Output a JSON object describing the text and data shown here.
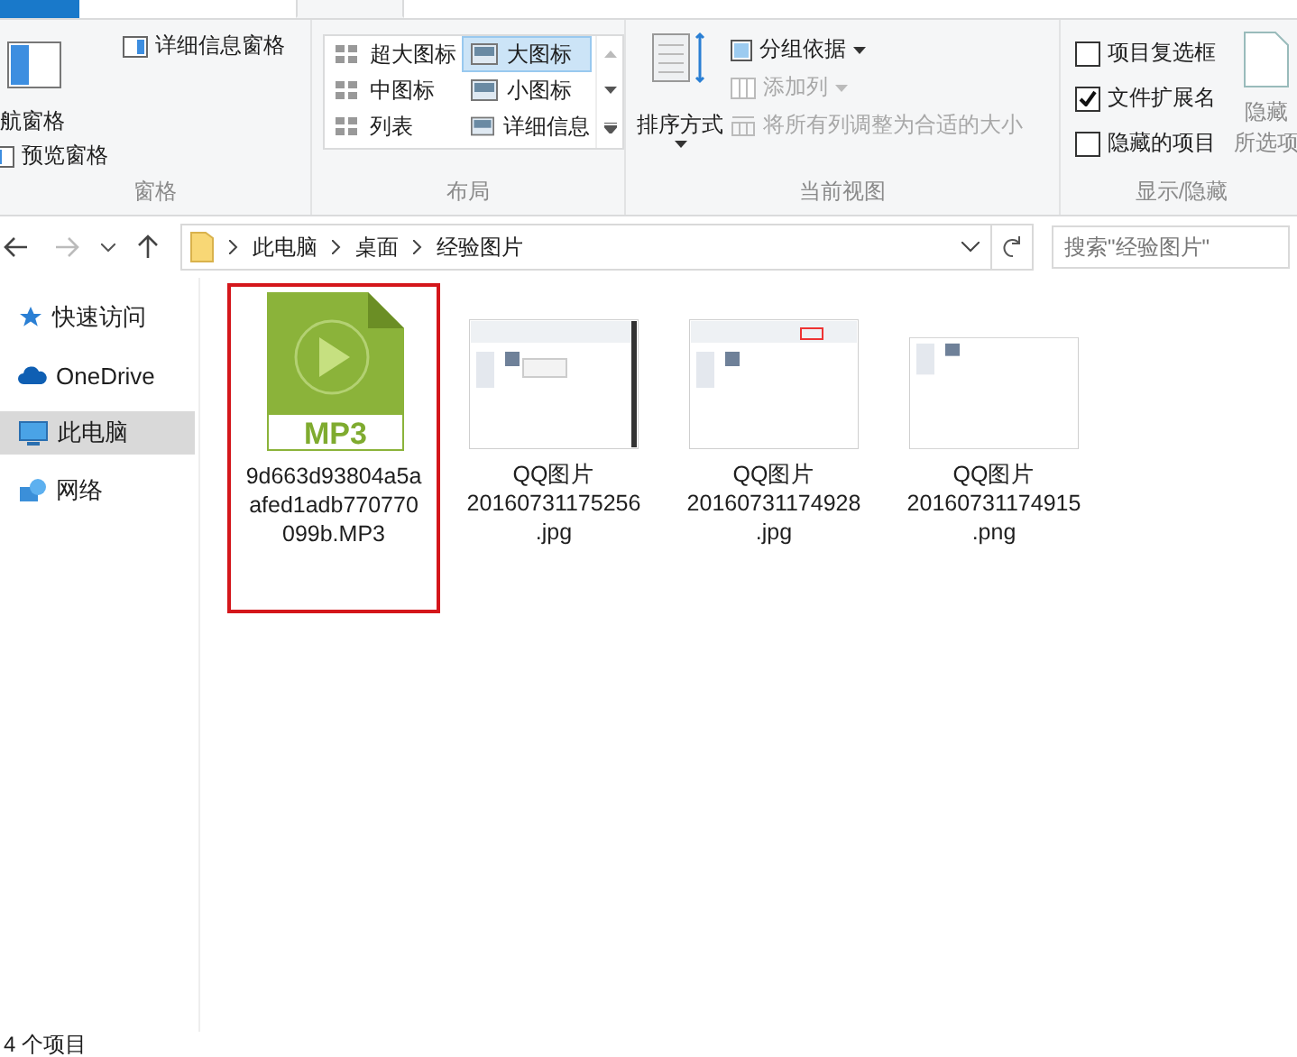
{
  "ribbon": {
    "panes": {
      "nav_pane": "航窗格",
      "preview_pane": "预览窗格",
      "details_pane": "详细信息窗格",
      "label": "窗格"
    },
    "layout": {
      "options": [
        {
          "label": "超大图标",
          "selected": false
        },
        {
          "label": "大图标",
          "selected": true
        },
        {
          "label": "中图标",
          "selected": false
        },
        {
          "label": "小图标",
          "selected": false
        },
        {
          "label": "列表",
          "selected": false
        },
        {
          "label": "详细信息",
          "selected": false
        }
      ],
      "label": "布局"
    },
    "current_view": {
      "sort": "排序方式",
      "group_by": "分组依据",
      "add_column": {
        "label": "添加列",
        "disabled": true
      },
      "fit_columns": {
        "label": "将所有列调整为合适的大小",
        "disabled": true
      },
      "label": "当前视图"
    },
    "show_hide": {
      "checkboxes": [
        {
          "label": "项目复选框",
          "checked": false
        },
        {
          "label": "文件扩展名",
          "checked": true
        },
        {
          "label": "隐藏的项目",
          "checked": false
        }
      ],
      "hide_selected": [
        "隐藏",
        "所选项"
      ],
      "label": "显示/隐藏"
    }
  },
  "address_bar": {
    "path": [
      "此电脑",
      "桌面",
      "经验图片"
    ],
    "search": {
      "placeholder": "搜索\"经验图片\""
    }
  },
  "nav_pane": {
    "items": [
      {
        "label": "快速访问",
        "kind": "star",
        "selected": false
      },
      {
        "label": "OneDrive",
        "kind": "cloud",
        "selected": false
      },
      {
        "label": "此电脑",
        "kind": "computer",
        "selected": true
      },
      {
        "label": "网络",
        "kind": "network",
        "selected": false
      }
    ]
  },
  "files": [
    {
      "name": "9d663d93804a5aafed1adb770770099b.MP3",
      "kind": "audio",
      "badge": "MP3",
      "selected": true
    },
    {
      "name": "QQ图片20160731175256.jpg",
      "selected": false
    },
    {
      "name": "QQ图片20160731174928.jpg",
      "selected": false
    },
    {
      "name": "QQ图片20160731174915.png",
      "selected": false
    }
  ],
  "status_bar": "4 个项目"
}
